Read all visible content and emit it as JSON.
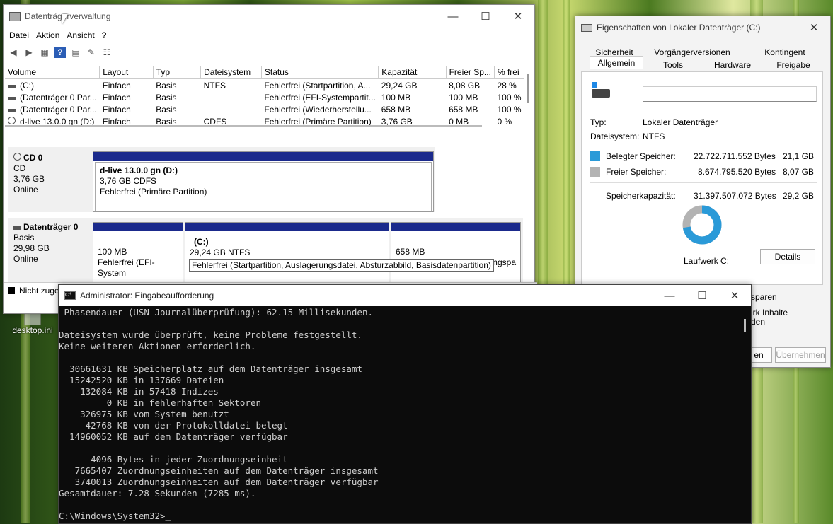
{
  "desktop": {
    "icon_label": "desktop.ini"
  },
  "dm": {
    "title": "Datenträgerverwaltung",
    "menu": [
      "Datei",
      "Aktion",
      "Ansicht",
      "?"
    ],
    "columns": [
      "Volume",
      "Layout",
      "Typ",
      "Dateisystem",
      "Status",
      "Kapazität",
      "Freier Sp...",
      "% frei"
    ],
    "rows": [
      [
        "(C:)",
        "Einfach",
        "Basis",
        "NTFS",
        "Fehlerfrei (Startpartition, A...",
        "29,24 GB",
        "8,08 GB",
        "28 %"
      ],
      [
        "(Datenträger 0 Par...",
        "Einfach",
        "Basis",
        "",
        "Fehlerfrei (EFI-Systempartit...",
        "100 MB",
        "100 MB",
        "100 %"
      ],
      [
        "(Datenträger 0 Par...",
        "Einfach",
        "Basis",
        "",
        "Fehlerfrei (Wiederherstellu...",
        "658 MB",
        "658 MB",
        "100 %"
      ],
      [
        "d-live 13.0.0 gn (D:)",
        "Einfach",
        "Basis",
        "CDFS",
        "Fehlerfrei (Primäre Partition)",
        "3,76 GB",
        "0 MB",
        "0 %"
      ]
    ],
    "cd0": {
      "name": "CD 0",
      "type": "CD",
      "size": "3,76 GB",
      "state": "Online",
      "part_name": "d-live 13.0.0 gn  (D:)",
      "part_size": "3,76 GB CDFS",
      "part_status": "Fehlerfrei (Primäre Partition)"
    },
    "disk0": {
      "name": "Datenträger 0",
      "type": "Basis",
      "size": "29,98 GB",
      "state": "Online",
      "p1_size": "100 MB",
      "p1_status": "Fehlerfrei (EFI-System",
      "p2_name": "(C:)",
      "p2_size": "29,24 GB NTFS",
      "p2_status": "Fehlerfrei (Startpartition, Auslagerungsdatei, Absturzabbild, Basisdatenpartition)",
      "p3_size": "658 MB",
      "p3_status_tail": "ungspa"
    },
    "legend": "Nicht zuge"
  },
  "props": {
    "title": "Eigenschaften von Lokaler Datenträger (C:)",
    "tabs_row1": [
      "Sicherheit",
      "Vorgängerversionen",
      "Kontingent"
    ],
    "tabs_row2": [
      "Allgemein",
      "Tools",
      "Hardware",
      "Freigabe"
    ],
    "label_value": "",
    "typ_label": "Typ:",
    "typ_value": "Lokaler Datenträger",
    "fs_label": "Dateisystem:",
    "fs_value": "NTFS",
    "used_label": "Belegter Speicher:",
    "used_bytes": "22.722.711.552 Bytes",
    "used_gb": "21,1 GB",
    "free_label": "Freier Speicher:",
    "free_bytes": "8.674.795.520 Bytes",
    "free_gb": "8,07 GB",
    "cap_label": "Speicherkapazität:",
    "cap_bytes": "31.397.507.072 Bytes",
    "cap_gb": "29,2 GB",
    "drive_label": "Laufwerk C:",
    "details_button": "Details",
    "behind_text_1": "sparen",
    "behind_text_2": "erk Inhalte",
    "behind_text_3": "rden",
    "ok_button_tail": "en",
    "apply_button": "Übernehmen",
    "used_color": "#2a9ad8",
    "free_color": "#b3b3b3",
    "used_fraction": 0.724
  },
  "cmd": {
    "title": "Administrator: Eingabeaufforderung",
    "lines": [
      " Phasendauer (USN-Journalüberprüfung): 62.15 Millisekunden.",
      "",
      "Dateisystem wurde überprüft, keine Probleme festgestellt.",
      "Keine weiteren Aktionen erforderlich.",
      "",
      "  30661631 KB Speicherplatz auf dem Datenträger insgesamt",
      "  15242520 KB in 137669 Dateien",
      "    132084 KB in 57418 Indizes",
      "         0 KB in fehlerhaften Sektoren",
      "    326975 KB vom System benutzt",
      "     42768 KB von der Protokolldatei belegt",
      "  14960052 KB auf dem Datenträger verfügbar",
      "",
      "      4096 Bytes in jeder Zuordnungseinheit",
      "   7665407 Zuordnungseinheiten auf dem Datenträger insgesamt",
      "   3740013 Zuordnungseinheiten auf dem Datenträger verfügbar",
      "Gesamtdauer: 7.28 Sekunden (7285 ms).",
      "",
      "C:\\Windows\\System32>"
    ]
  }
}
